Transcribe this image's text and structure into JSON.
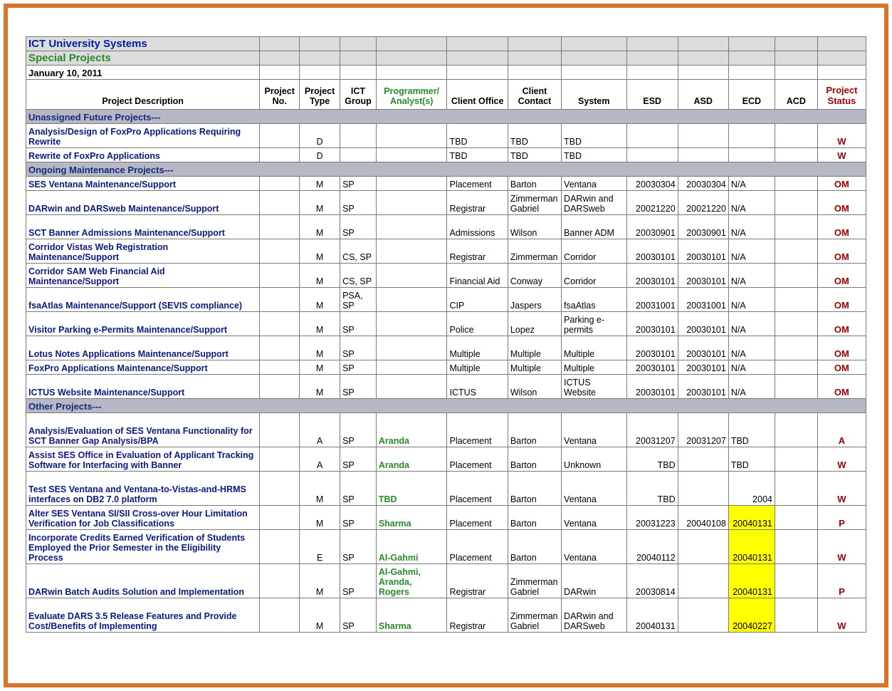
{
  "header": {
    "title1": "ICT University Systems",
    "title2": "Special Projects",
    "date": "January 10, 2011"
  },
  "columns": {
    "desc": "Project Description",
    "no": "Project No.",
    "type": "Project Type",
    "group": "ICT Group",
    "prog": "Programmer/ Analyst(s)",
    "coff": "Client Office",
    "contact": "Client Contact",
    "system": "System",
    "esd": "ESD",
    "asd": "ASD",
    "ecd": "ECD",
    "acd": "ACD",
    "status": "Project Status"
  },
  "sections": {
    "s1": "Unassigned Future Projects---",
    "s2": "Ongoing Maintenance Projects---",
    "s3": "Other Projects---"
  },
  "rows": [
    {
      "h": "h2",
      "desc": "Analysis/Design of FoxPro Applications Requiring Rewrite",
      "no": "",
      "type": "D",
      "group": "",
      "prog": "",
      "coff": "TBD",
      "contact": "TBD",
      "system": "TBD",
      "esd": "",
      "asd": "",
      "ecd": "",
      "acd": "",
      "status": "W"
    },
    {
      "h": "",
      "desc": "Rewrite of FoxPro Applications",
      "no": "",
      "type": "D",
      "group": "",
      "prog": "",
      "coff": "TBD",
      "contact": "TBD",
      "system": "TBD",
      "esd": "",
      "asd": "",
      "ecd": "",
      "acd": "",
      "status": "W"
    },
    {
      "h": "",
      "desc": "SES Ventana Maintenance/Support",
      "no": "",
      "type": "M",
      "group": "SP",
      "prog": "",
      "coff": "Placement",
      "contact": "Barton",
      "system": "Ventana",
      "esd": "20030304",
      "asd": "20030304",
      "ecd": "N/A",
      "acd": "",
      "status": "OM"
    },
    {
      "h": "h2",
      "desc": "DARwin and DARSweb Maintenance/Support",
      "no": "",
      "type": "M",
      "group": "SP",
      "prog": "",
      "coff": "Registrar",
      "contact": "Zimmerman Gabriel",
      "system": "DARwin and DARSweb",
      "esd": "20021220",
      "asd": "20021220",
      "ecd": "N/A",
      "acd": "",
      "status": "OM"
    },
    {
      "h": "h2",
      "desc": "SCT Banner Admissions Maintenance/Support",
      "no": "",
      "type": "M",
      "group": "SP",
      "prog": "",
      "coff": "Admissions",
      "contact": "Wilson",
      "system": "Banner ADM",
      "esd": "20030901",
      "asd": "20030901",
      "ecd": "N/A",
      "acd": "",
      "status": "OM"
    },
    {
      "h": "h2",
      "desc": "Corridor Vistas Web Registration Maintenance/Support",
      "no": "",
      "type": "M",
      "group": "CS, SP",
      "prog": "",
      "coff": "Registrar",
      "contact": "Zimmerman",
      "system": "Corridor",
      "esd": "20030101",
      "asd": "20030101",
      "ecd": "N/A",
      "acd": "",
      "status": "OM"
    },
    {
      "h": "h2",
      "desc": "Corridor SAM Web Financial Aid Maintenance/Support",
      "no": "",
      "type": "M",
      "group": "CS, SP",
      "prog": "",
      "coff": "Financial Aid",
      "contact": "Conway",
      "system": "Corridor",
      "esd": "20030101",
      "asd": "20030101",
      "ecd": "N/A",
      "acd": "",
      "status": "OM"
    },
    {
      "h": "h2",
      "desc": "fsaAtlas Maintenance/Support (SEVIS compliance)",
      "no": "",
      "type": "M",
      "group": "PSA, SP",
      "prog": "",
      "coff": "CIP",
      "contact": "Jaspers",
      "system": "fsaAtlas",
      "esd": "20031001",
      "asd": "20031001",
      "ecd": "N/A",
      "acd": "",
      "status": "OM"
    },
    {
      "h": "h2",
      "desc": "Visitor Parking e-Permits Maintenance/Support",
      "no": "",
      "type": "M",
      "group": "SP",
      "prog": "",
      "coff": "Police",
      "contact": "Lopez",
      "system": "Parking e-permits",
      "esd": "20030101",
      "asd": "20030101",
      "ecd": "N/A",
      "acd": "",
      "status": "OM"
    },
    {
      "h": "h2",
      "desc": "Lotus Notes Applications Maintenance/Support",
      "no": "",
      "type": "M",
      "group": "SP",
      "prog": "",
      "coff": "Multiple",
      "contact": "Multiple",
      "system": "Multiple",
      "esd": "20030101",
      "asd": "20030101",
      "ecd": "N/A",
      "acd": "",
      "status": "OM"
    },
    {
      "h": "",
      "desc": "FoxPro Applications Maintenance/Support",
      "no": "",
      "type": "M",
      "group": "SP",
      "prog": "",
      "coff": "Multiple",
      "contact": "Multiple",
      "system": "Multiple",
      "esd": "20030101",
      "asd": "20030101",
      "ecd": "N/A",
      "acd": "",
      "status": "OM"
    },
    {
      "h": "h2",
      "desc": "ICTUS Website Maintenance/Support",
      "no": "",
      "type": "M",
      "group": "SP",
      "prog": "",
      "coff": "ICTUS",
      "contact": "Wilson",
      "system": "ICTUS Website",
      "esd": "20030101",
      "asd": "20030101",
      "ecd": "N/A",
      "acd": "",
      "status": "OM"
    },
    {
      "h": "h3",
      "desc": "Analysis/Evaluation of SES Ventana Functionality for SCT Banner Gap Analysis/BPA",
      "no": "",
      "type": "A",
      "group": "SP",
      "prog": "Aranda",
      "coff": "Placement",
      "contact": "Barton",
      "system": "Ventana",
      "esd": "20031207",
      "asd": "20031207",
      "ecd": "TBD",
      "acd": "",
      "status": "A"
    },
    {
      "h": "h2",
      "desc": "Assist SES Office in Evaluation of Applicant Tracking Software for Interfacing with Banner",
      "no": "",
      "type": "A",
      "group": "SP",
      "prog": "Aranda",
      "coff": "Placement",
      "contact": "Barton",
      "system": "Unknown",
      "esd": "TBD",
      "asd": "",
      "ecd": "TBD",
      "acd": "",
      "status": "W"
    },
    {
      "h": "h3",
      "desc": "Test SES Ventana and Ventana-to-Vistas-and-HRMS interfaces on DB2 7.0 platform",
      "no": "",
      "type": "M",
      "group": "SP",
      "prog": "TBD",
      "coff": "Placement",
      "contact": "Barton",
      "system": "Ventana",
      "esd": "TBD",
      "asd": "",
      "ecd": "2004",
      "acd": "",
      "status": "W"
    },
    {
      "h": "h2",
      "desc": "Alter SES Ventana SI/SII Cross-over Hour Limitation Verification for Job Classifications",
      "no": "",
      "type": "M",
      "group": "SP",
      "prog": "Sharma",
      "coff": "Placement",
      "contact": "Barton",
      "system": "Ventana",
      "esd": "20031223",
      "asd": "20040108",
      "ecd": "20040131",
      "ecd_hl": true,
      "acd": "",
      "status": "P"
    },
    {
      "h": "h3",
      "desc": "Incorporate Credits Earned Verification of Students Employed the Prior Semester in the Eligibility Process",
      "no": "",
      "type": "E",
      "group": "SP",
      "prog": "Al-Gahmi",
      "coff": "Placement",
      "contact": "Barton",
      "system": "Ventana",
      "esd": "20040112",
      "asd": "",
      "ecd": "20040131",
      "ecd_hl": true,
      "acd": "",
      "status": "W"
    },
    {
      "h": "h3",
      "desc": "DARwin Batch Audits Solution and Implementation",
      "no": "",
      "type": "M",
      "group": "SP",
      "prog": "Al-Gahmi, Aranda, Rogers",
      "coff": "Registrar",
      "contact": "Zimmerman Gabriel",
      "system": "DARwin",
      "esd": "20030814",
      "asd": "",
      "ecd": "20040131",
      "ecd_hl": true,
      "acd": "",
      "status": "P"
    },
    {
      "h": "h3",
      "desc": "Evaluate DARS 3.5 Release Features and Provide Cost/Benefits of Implementing",
      "no": "",
      "type": "M",
      "group": "SP",
      "prog": "Sharma",
      "coff": "Registrar",
      "contact": "Zimmerman Gabriel",
      "system": "DARwin and DARSweb",
      "esd": "20040131",
      "asd": "",
      "ecd": "20040227",
      "ecd_hl": true,
      "acd": "",
      "status": "W"
    }
  ]
}
